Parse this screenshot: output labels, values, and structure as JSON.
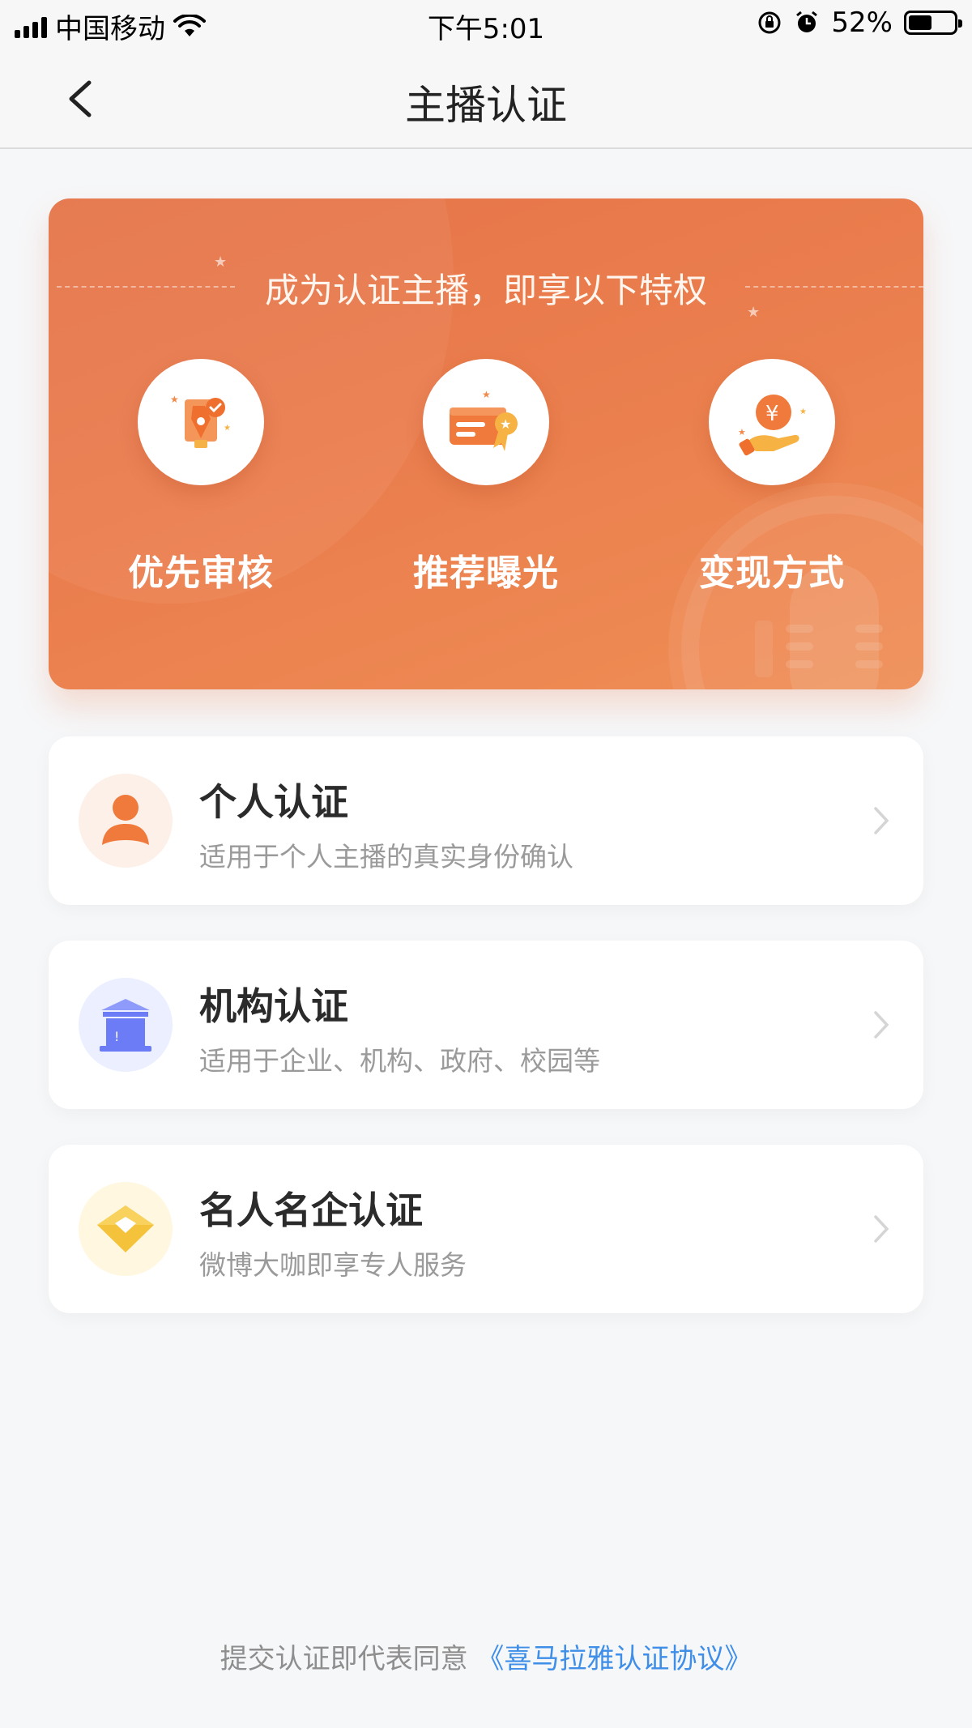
{
  "status_bar": {
    "carrier": "中国移动",
    "time": "下午5:01",
    "battery": "52%",
    "battery_level": 0.52
  },
  "nav": {
    "title": "主播认证"
  },
  "banner": {
    "headline": "成为认证主播，即享以下特权",
    "benefits": [
      {
        "label": "优先审核",
        "icon": "pen-badge-icon"
      },
      {
        "label": "推荐曝光",
        "icon": "card-star-icon"
      },
      {
        "label": "变现方式",
        "icon": "coin-hand-icon"
      }
    ]
  },
  "cards": [
    {
      "title": "个人认证",
      "desc": "适用于个人主播的真实身份确认",
      "icon": "person-icon"
    },
    {
      "title": "机构认证",
      "desc": "适用于企业、机构、政府、校园等",
      "icon": "building-icon"
    },
    {
      "title": "名人名企认证",
      "desc": "微博大咖即享专人服务",
      "icon": "diamond-icon"
    }
  ],
  "footer": {
    "text": "提交认证即代表同意",
    "link": "《喜马拉雅认证协议》"
  },
  "colors": {
    "banner_orange": "#ea7d4d",
    "link_blue": "#3f8ee8",
    "person_orange": "#f07a3c",
    "building_blue": "#6b7cf6",
    "diamond_yellow": "#f5c33b"
  }
}
